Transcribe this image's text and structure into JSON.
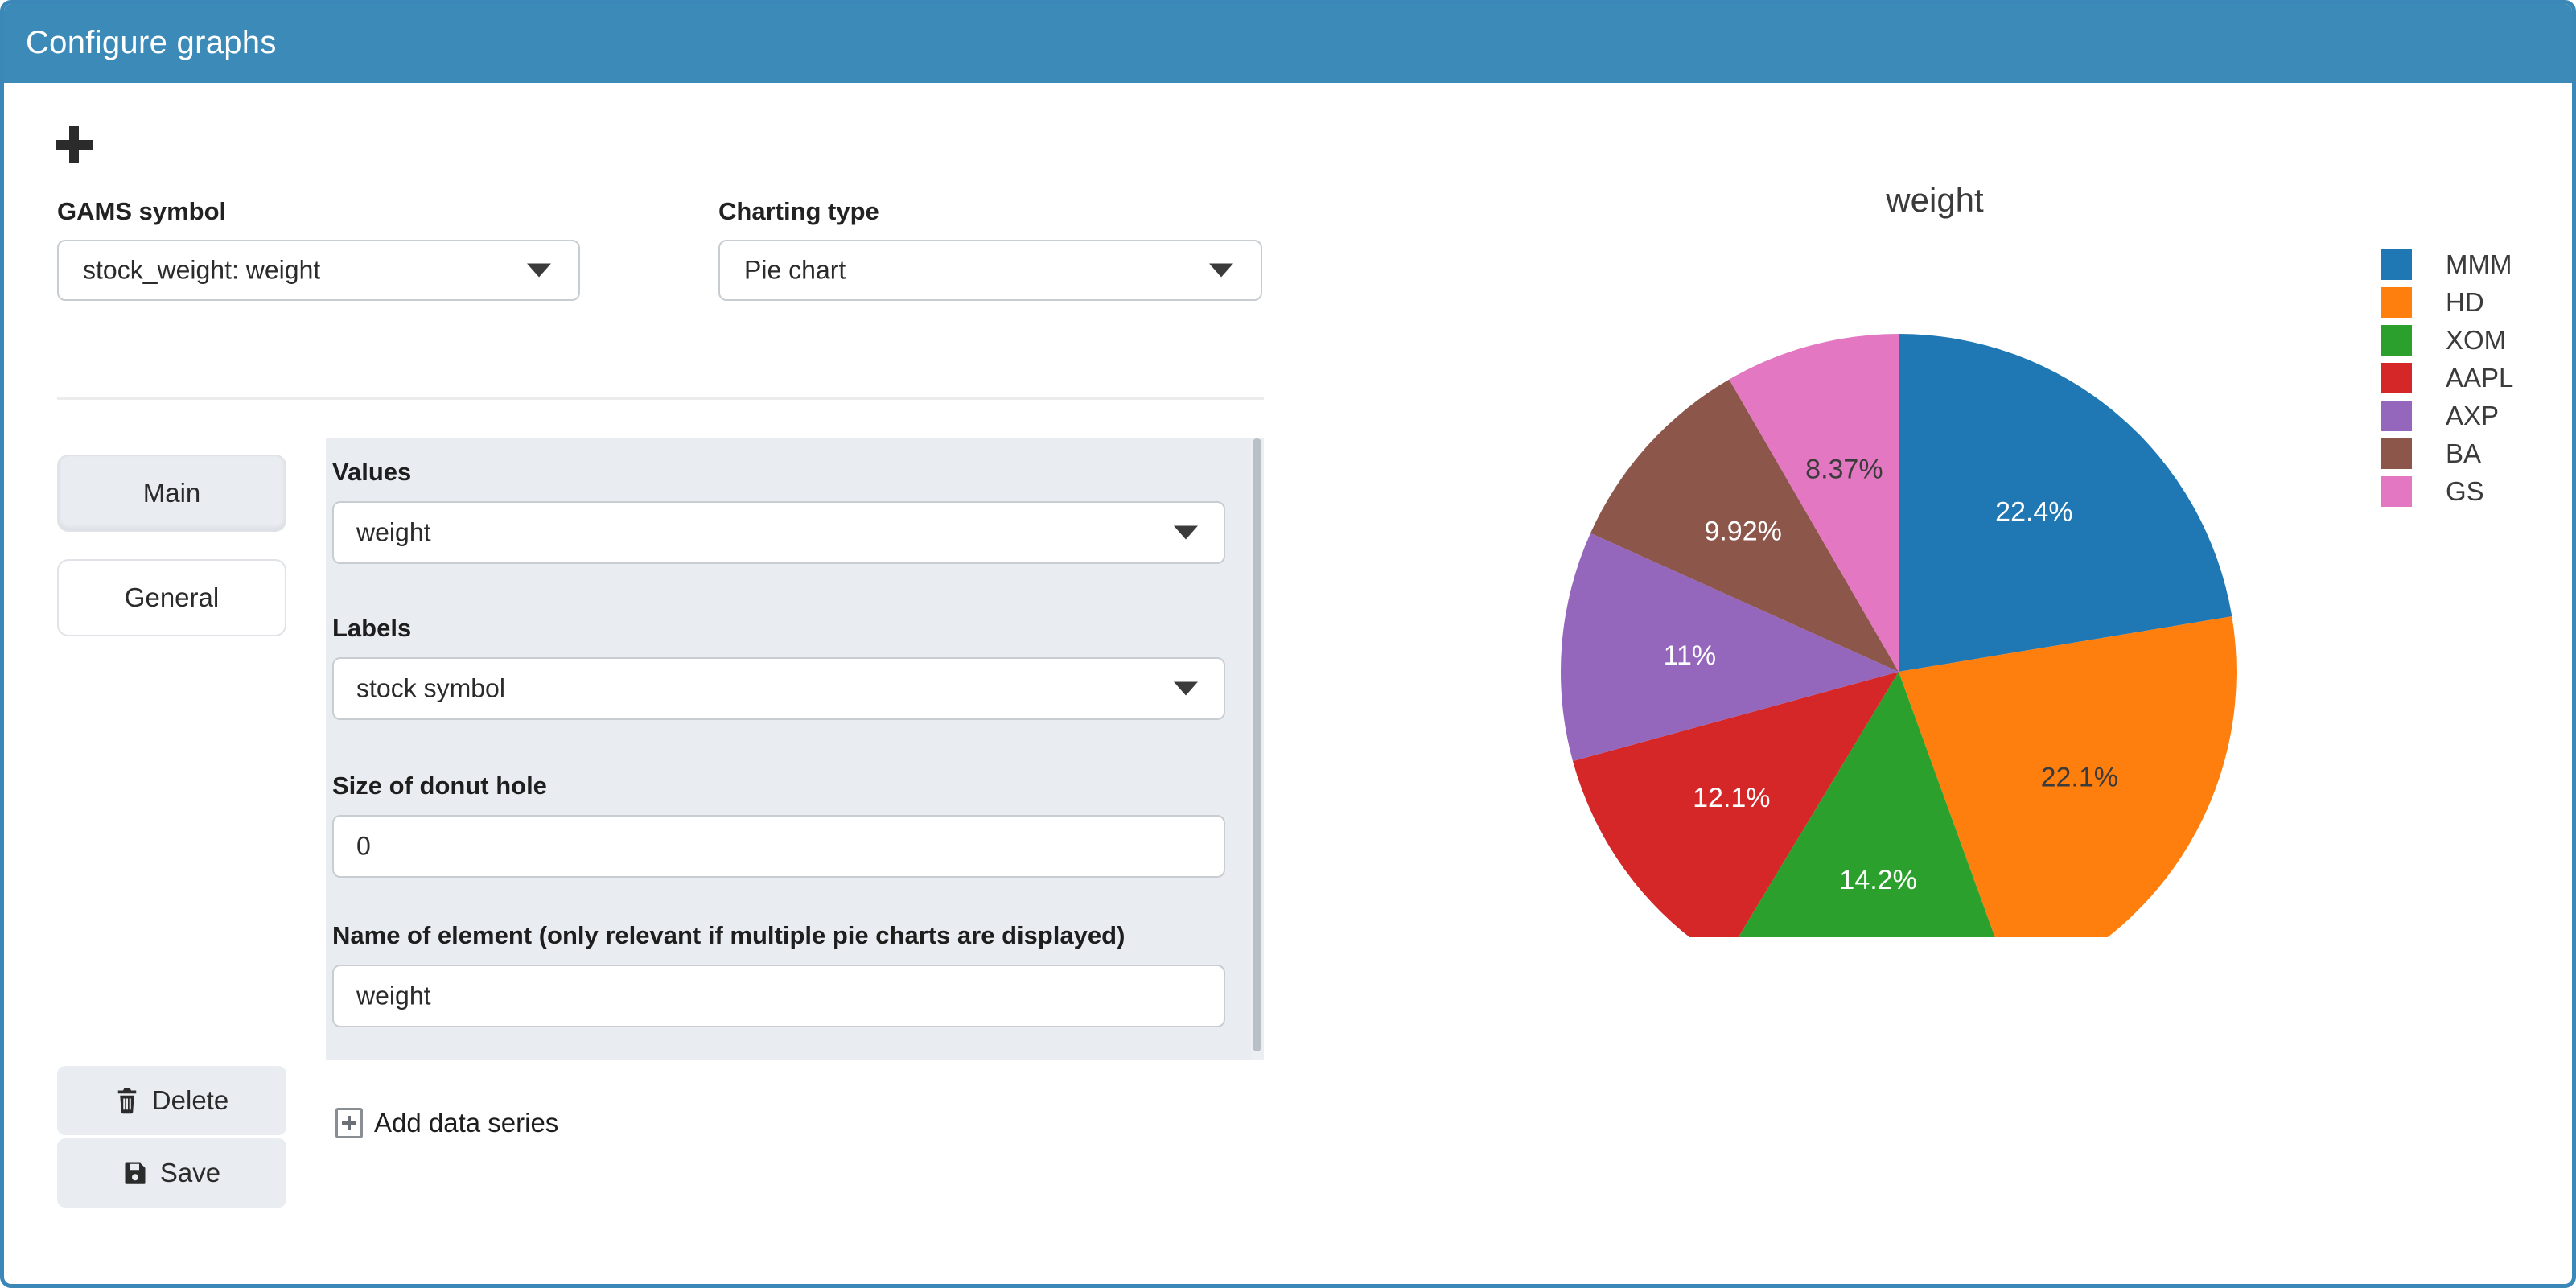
{
  "window": {
    "title": "Configure graphs",
    "titlebar_color": "#3b8ab8",
    "border_color": "#3b87b8"
  },
  "toolbar": {
    "add_icon": "plus-icon"
  },
  "form": {
    "gams_symbol": {
      "label": "GAMS symbol",
      "value": "stock_weight: weight"
    },
    "charting_type": {
      "label": "Charting type",
      "value": "Pie chart"
    }
  },
  "tabs": [
    {
      "label": "Main",
      "active": true
    },
    {
      "label": "General",
      "active": false
    }
  ],
  "panel": {
    "values": {
      "label": "Values",
      "value": "weight"
    },
    "labels": {
      "label": "Labels",
      "value": "stock symbol"
    },
    "donut_hole": {
      "label": "Size of donut hole",
      "value": "0"
    },
    "element_name": {
      "label": "Name of element (only relevant if multiple pie charts are displayed)",
      "value": "weight"
    }
  },
  "actions": {
    "delete_label": "Delete",
    "delete_icon": "trash-icon",
    "save_label": "Save",
    "save_icon": "floppy-disk-icon",
    "add_series_label": "Add data series",
    "add_series_icon": "plus-box-icon"
  },
  "chart_data": {
    "type": "pie",
    "title": "weight",
    "xlabel": "",
    "ylabel": "",
    "legend_position": "right",
    "start_angle_deg": 90,
    "direction": "clockwise",
    "donut_hole": 0,
    "categories": [
      "MMM",
      "HD",
      "XOM",
      "AAPL",
      "AXP",
      "BA",
      "GS"
    ],
    "values": [
      22.4,
      22.1,
      14.2,
      12.1,
      11.0,
      9.92,
      8.37
    ],
    "labels": [
      "22.4%",
      "22.1%",
      "14.2%",
      "12.1%",
      "11%",
      "9.92%",
      "8.37%"
    ],
    "label_text_colors": [
      "#ffffff",
      "#3b3b3b",
      "#ffffff",
      "#ffffff",
      "#ffffff",
      "#ffffff",
      "#3b3b3b"
    ],
    "colors": [
      "#1f77b4",
      "#ff7f0e",
      "#2ca02c",
      "#d62728",
      "#9467bd",
      "#8c564b",
      "#e377c2"
    ]
  }
}
